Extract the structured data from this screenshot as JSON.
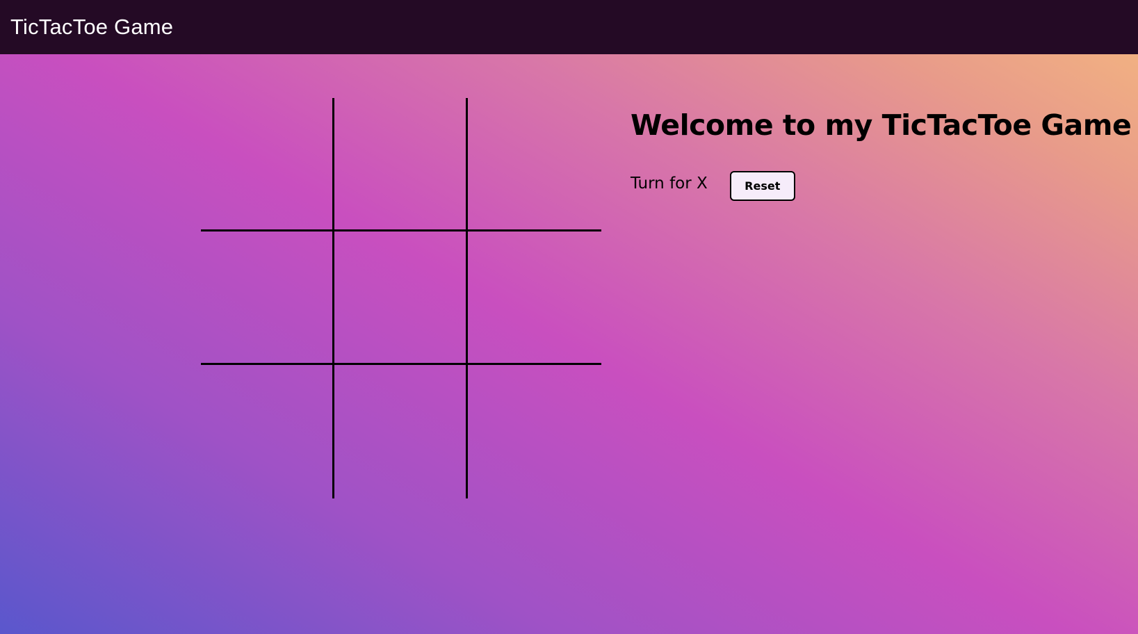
{
  "navbar": {
    "brand": "TicTacToe Game"
  },
  "board": {
    "cells": [
      "",
      "",
      "",
      "",
      "",
      "",
      "",
      "",
      ""
    ]
  },
  "info": {
    "heading": "Welcome to my TicTacToe Game",
    "turn_text": "Turn for X",
    "reset_label": "Reset"
  },
  "colors": {
    "navbar_bg": "#240a25",
    "grid_lines": "#000000",
    "button_bg": "#f6ecfa"
  }
}
